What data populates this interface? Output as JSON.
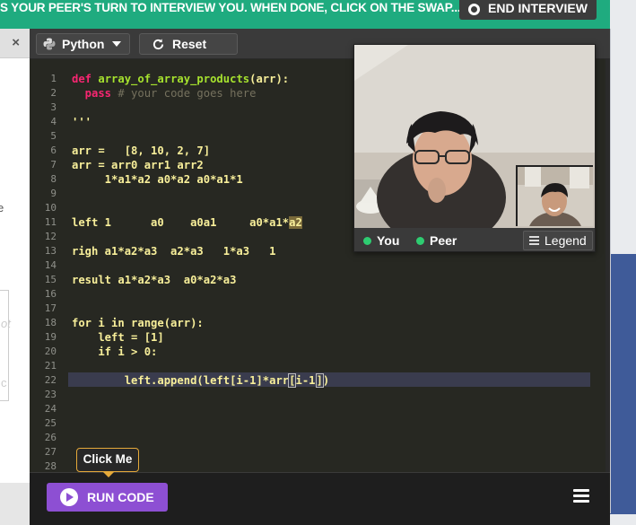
{
  "banner": {
    "text": "S YOUR PEER'S TURN TO INTERVIEW YOU. WHEN DONE, CLICK ON THE SWAP...",
    "end_label": "END INTERVIEW"
  },
  "left_panel": {
    "close_glyph": "×",
    "partial_char": "e",
    "ghost1": "ot",
    "ghost2": "c"
  },
  "toolbar": {
    "language": "Python",
    "reset_label": "Reset"
  },
  "editor": {
    "line_numbers": [
      "1",
      "2",
      "3",
      "4",
      "5",
      "6",
      "7",
      "8",
      "9",
      "10",
      "11",
      "12",
      "13",
      "14",
      "15",
      "16",
      "17",
      "18",
      "19",
      "20",
      "21",
      "22",
      "23",
      "24",
      "25",
      "26",
      "27",
      "28"
    ],
    "lines": {
      "l1_kw": "def ",
      "l1_fn": "array_of_array_products",
      "l1_rest": "(arr):",
      "l2_kw": "  pass ",
      "l2_cm": "# your code goes here",
      "l4": "'''",
      "l6": "arr =   [8, 10, 2, 7]",
      "l7": "arr = arr0 arr1 arr2",
      "l8": "     1*a1*a2 a0*a2 a0*a1*1",
      "l11_a": "left 1      a0    a0a1     a0*a1*",
      "l11_b": "a2",
      "l13": "righ a1*a2*a3  a2*a3   1*a3   1",
      "l15": "result a1*a2*a3  a0*a2*a3",
      "l18": "for i in range(arr):",
      "l19": "    left = [1]",
      "l20": "    if i > 0:",
      "l22_a": "        left.append(left[i-1]*arr",
      "l22_b": "[",
      "l22_c": "i-1",
      "l22_d": "]",
      "l22_e": ")"
    }
  },
  "tooltip": {
    "label": "Click Me"
  },
  "run": {
    "label": "RUN CODE"
  },
  "video": {
    "you_label": "You",
    "peer_label": "Peer",
    "legend_label": "Legend"
  },
  "colors": {
    "banner": "#1fab7f",
    "run_button": "#8d4fd3",
    "editor_bg": "#272822",
    "presence": "#2ecc71"
  }
}
